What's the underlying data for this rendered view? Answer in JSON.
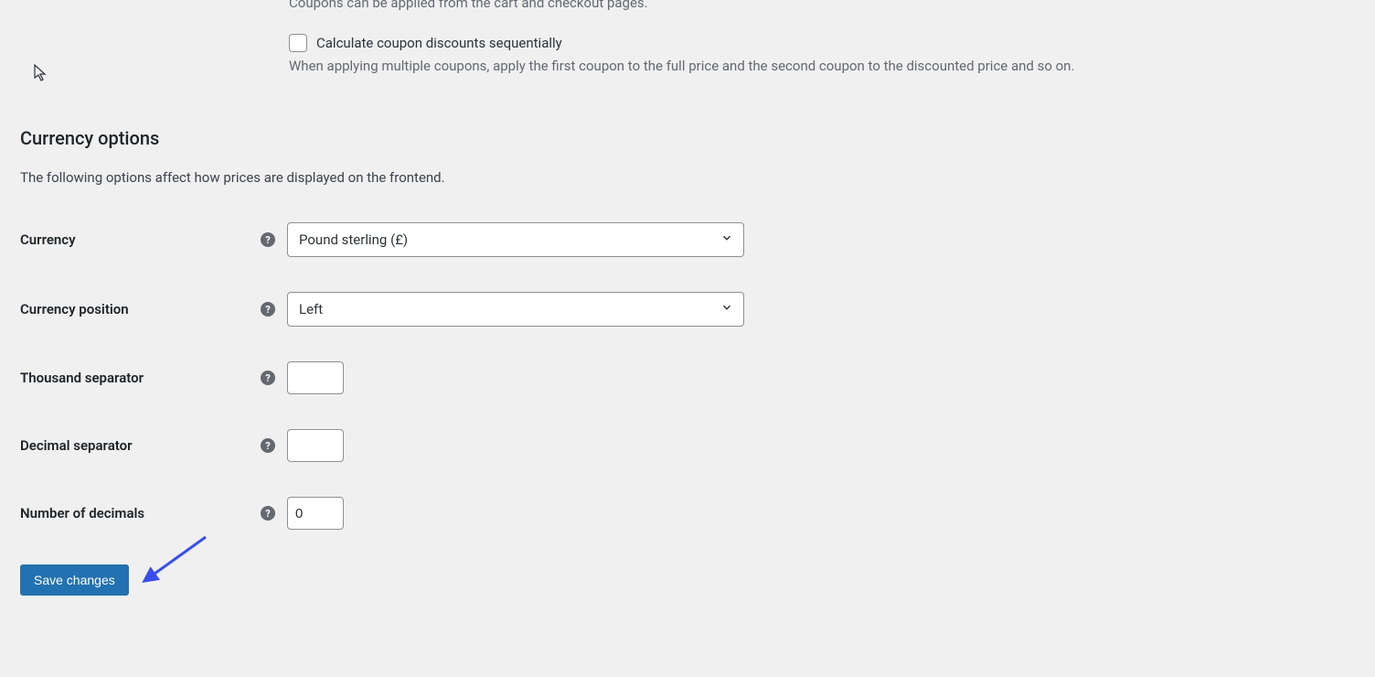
{
  "coupons": {
    "helper_text": "Coupons can be applied from the cart and checkout pages.",
    "sequential_label": "Calculate coupon discounts sequentially",
    "sequential_desc": "When applying multiple coupons, apply the first coupon to the full price and the second coupon to the discounted price and so on."
  },
  "currency_section": {
    "title": "Currency options",
    "desc": "The following options affect how prices are displayed on the frontend."
  },
  "fields": {
    "currency": {
      "label": "Currency",
      "value": "Pound sterling (£)"
    },
    "currency_position": {
      "label": "Currency position",
      "value": "Left"
    },
    "thousand_separator": {
      "label": "Thousand separator",
      "value": ""
    },
    "decimal_separator": {
      "label": "Decimal separator",
      "value": ""
    },
    "number_of_decimals": {
      "label": "Number of decimals",
      "value": "0"
    }
  },
  "actions": {
    "save_label": "Save changes"
  }
}
